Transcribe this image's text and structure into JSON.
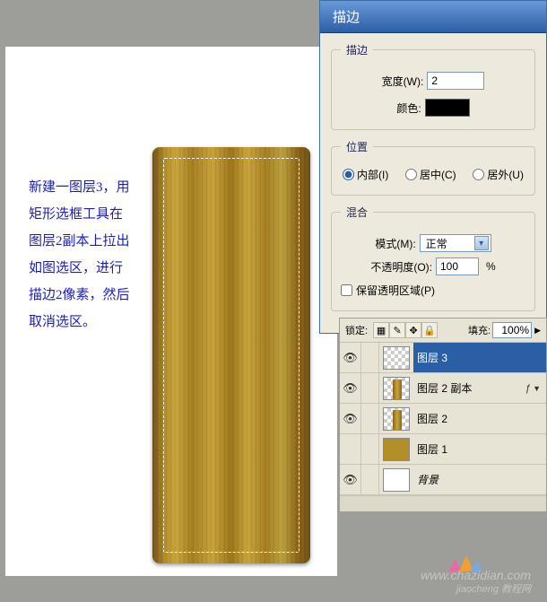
{
  "dialog": {
    "title": "描边",
    "stroke_group": "描边",
    "width_label": "宽度(W):",
    "width_value": "2",
    "color_label": "颜色:",
    "position_group": "位置",
    "pos_inside": "内部(I)",
    "pos_center": "居中(C)",
    "pos_outside": "居外(U)",
    "blend_group": "混合",
    "mode_label": "模式(M):",
    "mode_value": "正常",
    "opacity_label": "不透明度(O):",
    "opacity_value": "100",
    "opacity_pct": "%",
    "preserve_label": "保留透明区域(P)"
  },
  "instruction": {
    "l1": "新建一图层3，用",
    "l2": "矩形选框工具在",
    "l3": "图层2副本上拉出",
    "l4": "如图选区，进行",
    "l5": "描边2像素，然后",
    "l6": "取消选区。"
  },
  "layers": {
    "lock_label": "锁定:",
    "fill_label": "填充:",
    "fill_value": "100%",
    "items": [
      {
        "name": "图层 3",
        "selected": true,
        "thumb": "checker"
      },
      {
        "name": "图层 2 副本",
        "thumb": "wood",
        "fx": true
      },
      {
        "name": "图层 2",
        "thumb": "wood"
      },
      {
        "name": "图层 1",
        "thumb": "solid",
        "noeye": true
      },
      {
        "name": "背景",
        "thumb": "white",
        "italic": true
      }
    ]
  },
  "watermark": {
    "site": "www.chazidian.com",
    "sub": "jiaocheng 教程网"
  }
}
